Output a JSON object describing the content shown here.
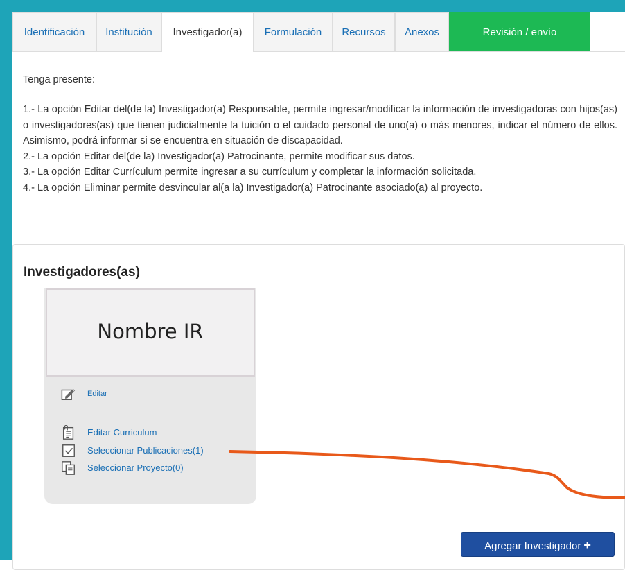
{
  "tabs": [
    {
      "label": "Identificación",
      "state": "default"
    },
    {
      "label": "Institución",
      "state": "default"
    },
    {
      "label": "Investigador(a)",
      "state": "active"
    },
    {
      "label": "Formulación",
      "state": "default"
    },
    {
      "label": "Recursos",
      "state": "default"
    },
    {
      "label": "Anexos",
      "state": "default"
    },
    {
      "label": "Revisión / envío",
      "state": "submit"
    }
  ],
  "notice": {
    "heading": "Tenga presente:",
    "items": [
      "1.- La opción Editar del(de la) Investigador(a) Responsable, permite ingresar/modificar la información de investigadoras con hijos(as) o investigadores(as) que tienen judicialmente la tuición o el cuidado personal de uno(a) o más menores, indicar el número de ellos. Asimismo, podrá informar si se encuentra en situación de discapacidad.",
      "2.- La opción Editar del(de la) Investigador(a) Patrocinante, permite modificar sus datos.",
      "3.- La opción Editar Currículum permite ingresar a su currículum y completar la información solicitada.",
      "4.- La opción Eliminar permite desvincular al(a la) Investigador(a) Patrocinante asociado(a) al proyecto."
    ]
  },
  "panel": {
    "title": "Investigadores(as)",
    "card": {
      "name": "Nombre IR",
      "edit_label": "Editar",
      "edit_cv_label": "Editar Curriculum",
      "select_publications_label": "Seleccionar Publicaciones(1)",
      "select_project_label": "Seleccionar Proyecto(0)"
    },
    "add_button_label": "Agregar Investigador",
    "add_button_icon": "plus-icon"
  },
  "colors": {
    "frame": "#1ea4b8",
    "submit_tab": "#1db954",
    "link": "#1a6fb5",
    "primary_button": "#1f4fa0",
    "annotation_line": "#e8591a"
  },
  "icons": {
    "edit": "edit-pencil-icon",
    "edit_cv": "document-clip-icon",
    "select_publications": "checkbox-icon",
    "select_project": "copy-icon"
  }
}
